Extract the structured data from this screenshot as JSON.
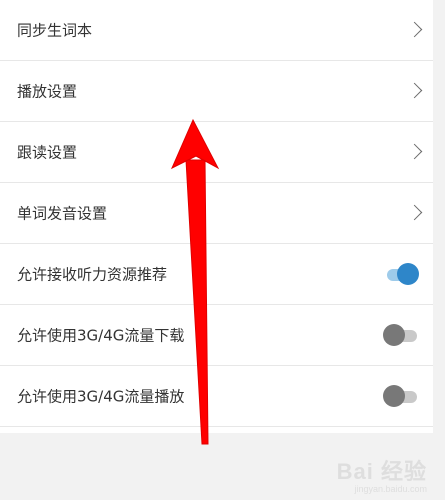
{
  "settings": {
    "rows": [
      {
        "label": "同步生词本",
        "control": "chevron"
      },
      {
        "label": "播放设置",
        "control": "chevron"
      },
      {
        "label": "跟读设置",
        "control": "chevron"
      },
      {
        "label": "单词发音设置",
        "control": "chevron"
      },
      {
        "label": "允许接收听力资源推荐",
        "control": "toggle",
        "on": true
      },
      {
        "label": "允许使用3G/4G流量下载",
        "control": "toggle",
        "on": false
      },
      {
        "label": "允许使用3G/4G流量播放",
        "control": "toggle",
        "on": false
      }
    ]
  },
  "icons": {
    "chevron": "chevron-right-icon",
    "annotation": "red-up-arrow"
  },
  "colors": {
    "toggle_on": "#2e86c9",
    "toggle_off": "#787878",
    "annotation_arrow": "#ff0000"
  },
  "watermark": {
    "main": "Bai 经验",
    "sub": "jingyan.baidu.com"
  }
}
